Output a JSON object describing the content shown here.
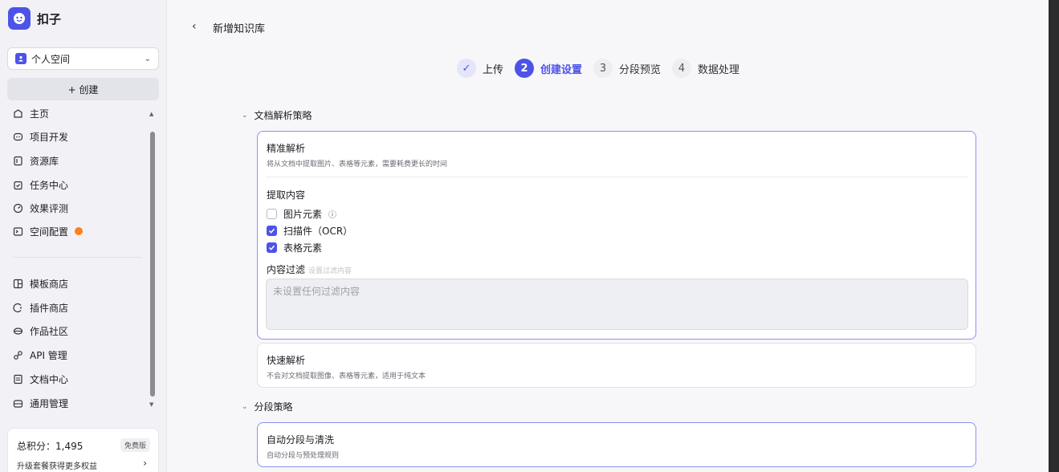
{
  "brand": {
    "name": "扣子"
  },
  "space": {
    "name": "个人空间"
  },
  "sidebar": {
    "create_label": "+ 创建",
    "items_top": [
      {
        "label": "主页",
        "icon": "home-icon"
      },
      {
        "label": "项目开发",
        "icon": "project-icon"
      },
      {
        "label": "资源库",
        "icon": "library-icon"
      },
      {
        "label": "任务中心",
        "icon": "task-icon"
      },
      {
        "label": "效果评测",
        "icon": "evaluation-icon"
      },
      {
        "label": "空间配置",
        "icon": "space-config-icon"
      }
    ],
    "items_bottom": [
      {
        "label": "模板商店",
        "icon": "template-icon"
      },
      {
        "label": "插件商店",
        "icon": "plugin-icon"
      },
      {
        "label": "作品社区",
        "icon": "community-icon"
      },
      {
        "label": "API 管理",
        "icon": "api-icon"
      },
      {
        "label": "文档中心",
        "icon": "doc-icon"
      },
      {
        "label": "通用管理",
        "icon": "admin-icon"
      }
    ],
    "points_label": "总积分：1,495",
    "plan_badge": "免费版",
    "upgrade_text": "升级套餐获得更多权益"
  },
  "header": {
    "back_icon": "chevron-left-icon",
    "title": "新增知识库"
  },
  "steps": [
    {
      "num": "✓",
      "label": "上传",
      "state": "done"
    },
    {
      "num": "2",
      "label": "创建设置",
      "state": "active"
    },
    {
      "num": "3",
      "label": "分段预览",
      "state": "todo"
    },
    {
      "num": "4",
      "label": "数据处理",
      "state": "todo"
    }
  ],
  "parse_section": {
    "title": "文档解析策略",
    "precise": {
      "title": "精准解析",
      "desc": "将从文档中提取图片、表格等元素，需要耗费更长的时间",
      "extract_title": "提取内容",
      "options": [
        {
          "label": "图片元素",
          "checked": false
        },
        {
          "label": "扫描件（OCR）",
          "checked": true
        },
        {
          "label": "表格元素",
          "checked": true
        }
      ],
      "filter_title": "内容过滤",
      "filter_hint": "设置过滤内容",
      "filter_placeholder": "未设置任何过滤内容"
    },
    "fast": {
      "title": "快速解析",
      "desc": "不会对文档提取图像、表格等元素，适用于纯文本"
    }
  },
  "segment_section": {
    "title": "分段策略",
    "auto": {
      "title": "自动分段与清洗",
      "desc": "自动分段与预处理规则"
    }
  },
  "colors": {
    "accent": "#4d53e8",
    "badge": "#ff811a"
  }
}
